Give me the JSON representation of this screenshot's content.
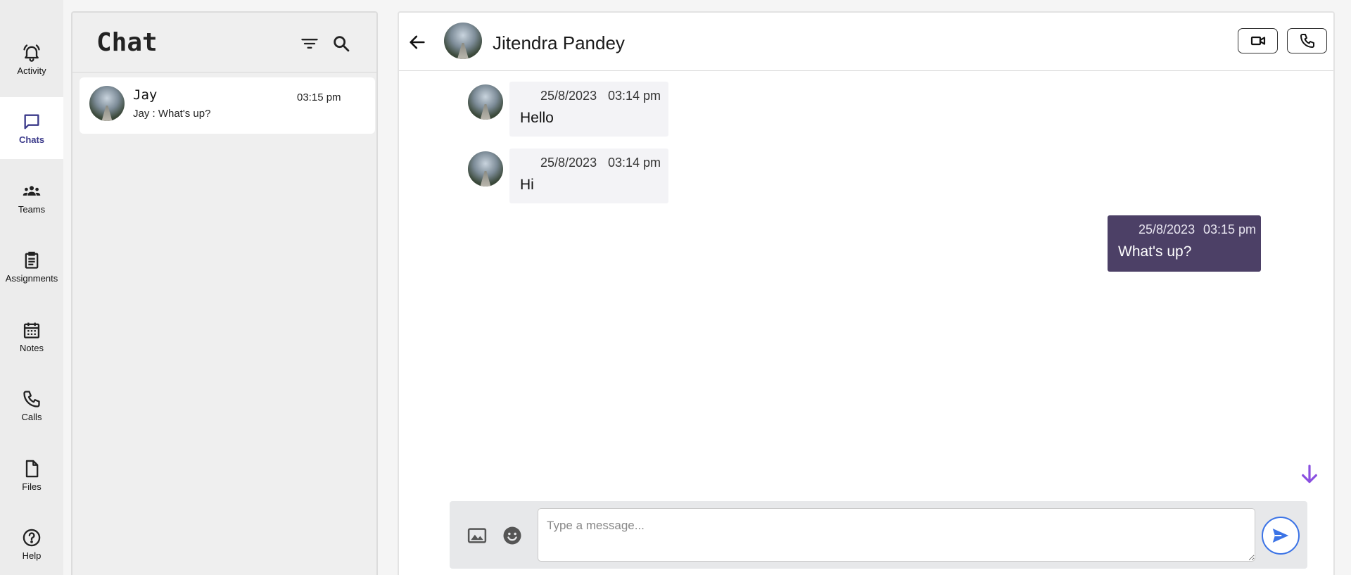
{
  "rail": {
    "items": [
      {
        "label": "Activity",
        "icon": "bell-icon"
      },
      {
        "label": "Chats",
        "icon": "chat-bubble-icon"
      },
      {
        "label": "Teams",
        "icon": "people-icon"
      },
      {
        "label": "Assignments",
        "icon": "clipboard-icon"
      },
      {
        "label": "Notes",
        "icon": "calendar-icon"
      },
      {
        "label": "Calls",
        "icon": "phone-icon"
      },
      {
        "label": "Files",
        "icon": "file-icon"
      },
      {
        "label": "Help",
        "icon": "help-circle-icon"
      }
    ],
    "active": "Chats",
    "accent": "#3b3a8a"
  },
  "chat_list": {
    "title": "Chat",
    "chats": [
      {
        "name": "Jay",
        "preview": "Jay : What's up?",
        "time": "03:15 pm"
      }
    ]
  },
  "conversation": {
    "contact_name": "Jitendra Pandey",
    "messages": [
      {
        "direction": "incoming",
        "date": "25/8/2023",
        "time": "03:14 pm",
        "text": "Hello"
      },
      {
        "direction": "incoming",
        "date": "25/8/2023",
        "time": "03:14 pm",
        "text": "Hi"
      },
      {
        "direction": "outgoing",
        "date": "25/8/2023",
        "time": "03:15 pm",
        "text": "What's up?"
      }
    ],
    "outgoing_bubble_color": "#4c4066",
    "incoming_bubble_color": "#f3f3f6"
  },
  "composer": {
    "placeholder": "Type a message...",
    "value": "",
    "send_color": "#3b73e6"
  },
  "scroll_arrow_color": "#8a4fe0"
}
